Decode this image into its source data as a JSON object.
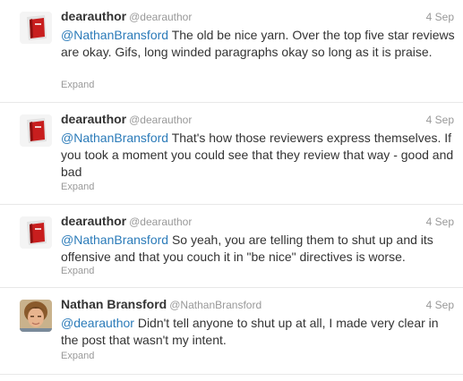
{
  "tweets": [
    {
      "name": "dearauthor",
      "handle": "@dearauthor",
      "time": "4 Sep",
      "mention": "@NathanBransford",
      "text": " The old be nice yarn. Over the top five star reviews are okay. Gifs, long winded paragraphs okay so long as it is praise.",
      "expand": "Expand",
      "avatar": "book-avatar-icon"
    },
    {
      "name": "dearauthor",
      "handle": "@dearauthor",
      "time": "4 Sep",
      "mention": "@NathanBransford",
      "text": " That's how those reviewers express themselves. If you took a moment you could see that they review that way - good and bad",
      "expand": "Expand",
      "avatar": "book-avatar-icon"
    },
    {
      "name": "dearauthor",
      "handle": "@dearauthor",
      "time": "4 Sep",
      "mention": "@NathanBransford",
      "text": " So yeah, you are telling them to shut up and its offensive and that you couch it in \"be nice\" directives is worse.",
      "expand": "Expand",
      "avatar": "book-avatar-icon"
    },
    {
      "name": "Nathan Bransford",
      "handle": "@NathanBransford",
      "time": "4 Sep",
      "mention": "@dearauthor",
      "text": " Didn't tell anyone to shut up at all, I made very clear in the post that wasn't my intent.",
      "expand": "Expand",
      "avatar": "profile-photo-avatar"
    }
  ],
  "colors": {
    "link": "#2b7bb9",
    "meta": "#999999",
    "text": "#333333",
    "divider": "#e8e8e8"
  }
}
